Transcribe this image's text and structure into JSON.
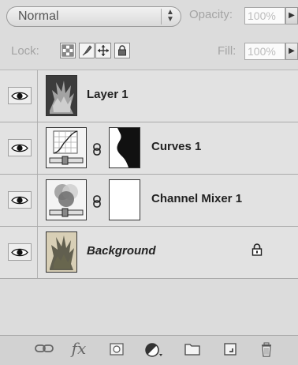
{
  "blend_mode": {
    "value": "Normal",
    "arrows": "▲▼"
  },
  "opacity": {
    "label": "Opacity:",
    "value": "100%",
    "arrow": "▶"
  },
  "lock": {
    "label": "Lock:"
  },
  "fill": {
    "label": "Fill:",
    "value": "100%",
    "arrow": "▶"
  },
  "layers": [
    {
      "name": "Layer 1",
      "visible": true
    },
    {
      "name": "Curves 1",
      "visible": true
    },
    {
      "name": "Channel Mixer 1",
      "visible": true
    },
    {
      "name": "Background",
      "visible": true,
      "locked": true
    }
  ],
  "toolbar": {
    "fx_label": "fx"
  }
}
